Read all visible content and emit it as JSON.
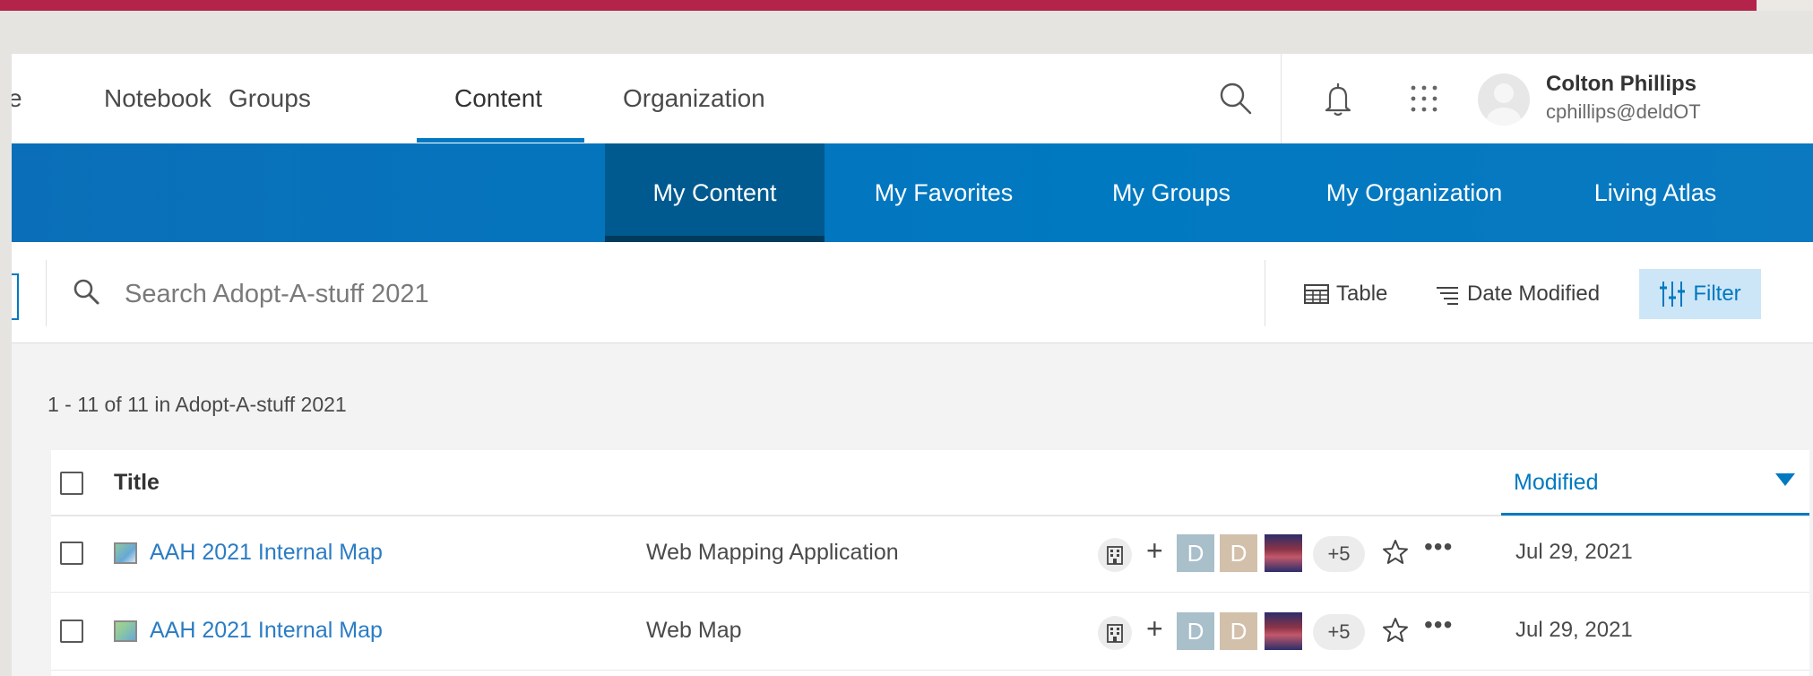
{
  "nav": {
    "items": [
      {
        "label": "e"
      },
      {
        "label": "Notebook"
      },
      {
        "label": "Groups"
      },
      {
        "label": "Content"
      },
      {
        "label": "Organization"
      }
    ],
    "active_index": 3
  },
  "user": {
    "name": "Colton Phillips",
    "email": "cphillips@deldOT"
  },
  "subnav": {
    "items": [
      {
        "label": "My Content"
      },
      {
        "label": "My Favorites"
      },
      {
        "label": "My Groups"
      },
      {
        "label": "My Organization"
      },
      {
        "label": "Living Atlas"
      }
    ],
    "active_index": 0
  },
  "search": {
    "placeholder": "Search Adopt-A-stuff 2021",
    "value": ""
  },
  "toolbar": {
    "view_label": "Table",
    "sort_label": "Date Modified",
    "filter_label": "Filter"
  },
  "results": {
    "count_text": "1 - 11 of 11 in Adopt-A-stuff 2021"
  },
  "table": {
    "headers": {
      "title": "Title",
      "modified": "Modified"
    },
    "rows": [
      {
        "title": "AAH 2021 Internal Map",
        "type": "Web Mapping Application",
        "thumb_icon": "web-app-icon",
        "shared_users": [
          "D",
          "D"
        ],
        "more_count": "+5",
        "modified": "Jul 29, 2021"
      },
      {
        "title": "AAH 2021 Internal Map",
        "type": "Web Map",
        "thumb_icon": "web-map-icon",
        "shared_users": [
          "D",
          "D"
        ],
        "more_count": "+5",
        "modified": "Jul 29, 2021"
      }
    ]
  },
  "colors": {
    "accent": "#0079c1",
    "subnav_active": "#005a8f",
    "top_rule": "#b3234a",
    "user_tile_1": "#a9bfca",
    "user_tile_2": "#d2c0ab"
  }
}
